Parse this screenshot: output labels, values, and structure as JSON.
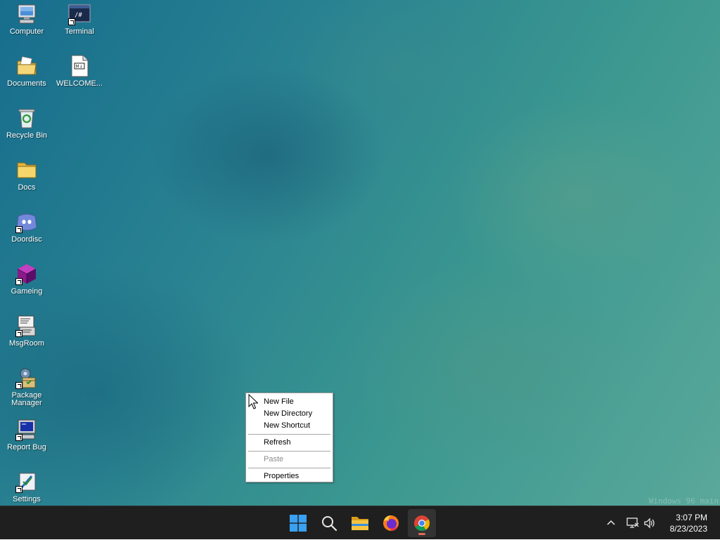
{
  "desktop": {
    "icons": [
      {
        "label": "Computer",
        "icon": "computer-icon"
      },
      {
        "label": "Terminal",
        "icon": "terminal-icon"
      },
      {
        "label": "Documents",
        "icon": "documents-folder-icon"
      },
      {
        "label": "WELCOME...",
        "icon": "markdown-file-icon"
      },
      {
        "label": "Recycle Bin",
        "icon": "recycle-bin-icon"
      },
      {
        "label": "Docs",
        "icon": "folder-icon"
      },
      {
        "label": "Doordisc",
        "icon": "doordisc-icon"
      },
      {
        "label": "Gameing",
        "icon": "gameing-cube-icon"
      },
      {
        "label": "MsgRoom",
        "icon": "msgroom-icon"
      },
      {
        "label": "Package Manager",
        "icon": "package-manager-icon"
      },
      {
        "label": "Report Bug",
        "icon": "report-bug-icon"
      },
      {
        "label": "Settings",
        "icon": "settings-icon"
      }
    ],
    "terminal_glyph": "/#",
    "markdown_glyph": "M↓",
    "watermark": "Windows 96 main"
  },
  "context_menu": {
    "items": [
      {
        "label": "New File",
        "enabled": true
      },
      {
        "label": "New Directory",
        "enabled": true
      },
      {
        "label": "New Shortcut",
        "enabled": true
      },
      {
        "label": "Refresh",
        "enabled": true
      },
      {
        "label": "Paste",
        "enabled": false
      },
      {
        "label": "Properties",
        "enabled": true
      }
    ]
  },
  "taskbar": {
    "buttons": [
      {
        "name": "start",
        "icon": "windows-logo-icon"
      },
      {
        "name": "search",
        "icon": "search-icon"
      },
      {
        "name": "file-explorer",
        "icon": "folder-icon"
      },
      {
        "name": "firefox",
        "icon": "firefox-icon"
      },
      {
        "name": "chrome",
        "icon": "chrome-icon",
        "active": true
      }
    ],
    "tray": {
      "chevron_icon": "chevron-up-icon",
      "network_icon": "network-icon",
      "volume_icon": "speaker-icon"
    },
    "clock": {
      "time": "3:07 PM",
      "date": "8/23/2023"
    }
  },
  "colors": {
    "taskbar_bg": "#1f1f1f",
    "desktop_accent": "#2a8391",
    "chrome_indicator": "#e06a5a"
  }
}
